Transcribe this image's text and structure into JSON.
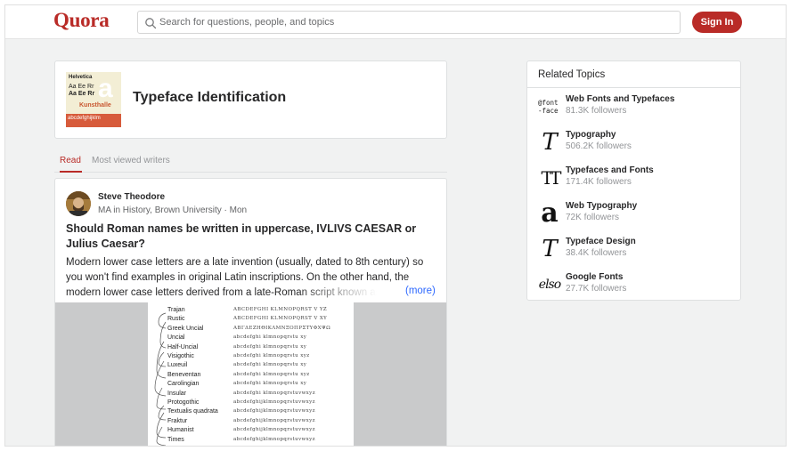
{
  "header": {
    "logo": "Quora",
    "search_placeholder": "Search for questions, people, and topics",
    "signin_label": "Sign In"
  },
  "topic": {
    "title": "Typeface Identification",
    "thumbnail": {
      "line1": "Helvetica",
      "line2": "Aa Ee Rr",
      "line3": "Aa Ee Rr",
      "big_letter": "a",
      "line4": "Kunsthalle",
      "line5": "abcdefghijklm"
    }
  },
  "tabs": [
    {
      "label": "Read",
      "active": true
    },
    {
      "label": "Most viewed writers",
      "active": false
    }
  ],
  "answer": {
    "author_name": "Steve Theodore",
    "author_meta": "MA in History, Brown University · Mon",
    "question": "Should Roman names be written in uppercase, IVLIVS CAESAR or Julius Caesar?",
    "text": "Modern lower case letters are a late invention (usually, dated to 8th century) so you won't find examples in original Latin inscriptions. On the other hand, the modern lower case letters derived from a late-Roman script known as",
    "more_label": "(more)",
    "image_scripts": [
      {
        "name": "Trajan",
        "sample": "ABCDEFGHI KLMNOPQRST V YZ"
      },
      {
        "name": "Rustic",
        "sample": "ABCDEFGHI KLMNOPQRST V XY"
      },
      {
        "name": "Greek Uncial",
        "sample": "ΑΒΓΔΕΖΗΘΙΚΛΜΝΞΟΠΡΣΤΥΦΧΨΩ"
      },
      {
        "name": "Uncial",
        "sample": "abcdefghi klmnopqrstu xy"
      },
      {
        "name": "Half-Uncial",
        "sample": "abcdefghi klmnopqrstu xy"
      },
      {
        "name": "Visigothic",
        "sample": "abcdefghi klmnopqrstu xyz"
      },
      {
        "name": "Luxeuil",
        "sample": "abcdefghi klmnopqrstu xy"
      },
      {
        "name": "Beneventan",
        "sample": "abcdefghi klmnopqrstu xyz"
      },
      {
        "name": "Carolingian",
        "sample": "abcdefghi klmnopqrstu xy"
      },
      {
        "name": "Insular",
        "sample": "abcdefghi klmnopqrstuvwxyz"
      },
      {
        "name": "Protogothic",
        "sample": "abcdefghijklmnopqrstuvwxyz"
      },
      {
        "name": "Textualis quadrata",
        "sample": "abcdefghijklmnopqrstuvwxyz"
      },
      {
        "name": "Fraktur",
        "sample": "abcdefghijklmnopqrstuvwxyz"
      },
      {
        "name": "Humanist",
        "sample": "abcdefghijklmnopqrstuvwxyz"
      },
      {
        "name": "Times",
        "sample": "abcdefghijklmnopqrstuvwxyz"
      }
    ]
  },
  "related": {
    "title": "Related Topics",
    "items": [
      {
        "name": "Web Fonts and Typefaces",
        "followers": "81.3K followers",
        "icon": "webfont-icon",
        "icon_text": "@font-face"
      },
      {
        "name": "Typography",
        "followers": "506.2K followers",
        "icon": "typography-icon",
        "icon_text": "T"
      },
      {
        "name": "Typefaces and Fonts",
        "followers": "171.4K followers",
        "icon": "typefaces-icon",
        "icon_text": "TT"
      },
      {
        "name": "Web Typography",
        "followers": "72K followers",
        "icon": "web-typography-icon",
        "icon_text": "a"
      },
      {
        "name": "Typeface Design",
        "followers": "38.4K followers",
        "icon": "typeface-design-icon",
        "icon_text": "T"
      },
      {
        "name": "Google Fonts",
        "followers": "27.7K followers",
        "icon": "google-fonts-icon",
        "icon_text": "elso"
      }
    ]
  },
  "colors": {
    "brand": "#b92b27",
    "link": "#2e69ff",
    "page_bg": "#f1f2f2"
  }
}
